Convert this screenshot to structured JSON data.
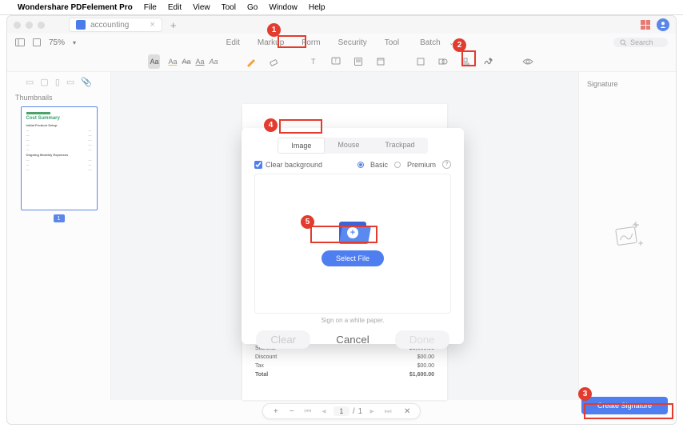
{
  "mac_menu": {
    "app_name": "Wondershare PDFelement Pro",
    "items": [
      "File",
      "Edit",
      "View",
      "Tool",
      "Go",
      "Window",
      "Help"
    ]
  },
  "document_tab": "accounting",
  "zoom": "75%",
  "ribbon": {
    "tabs": [
      "Edit",
      "Markup",
      "Form",
      "Security",
      "Tool",
      "Batch"
    ],
    "active": "Markup"
  },
  "search_placeholder": "Search",
  "sidebar": {
    "title": "Thumbnails",
    "page_number": "1"
  },
  "thumbnail": {
    "doc_title": "Cost Summary",
    "section1": "Initial Product Setup",
    "section2": "Ongoing Monthly Expenses"
  },
  "page_preview": {
    "rows": [
      {
        "label": "Subtotal",
        "value": "$1,600.00"
      },
      {
        "label": "Discount",
        "value": "$00.00"
      },
      {
        "label": "Tax",
        "value": "$00.00"
      },
      {
        "label": "Total",
        "value": "$1,600.00",
        "bold": true
      }
    ]
  },
  "right_panel": {
    "title": "Signature"
  },
  "pager": {
    "current": "1",
    "total": "1"
  },
  "dialog": {
    "tabs": [
      "Image",
      "Mouse",
      "Trackpad"
    ],
    "active": "Image",
    "clear_bg": "Clear background",
    "basic": "Basic",
    "premium": "Premium",
    "select_file": "Select File",
    "hint": "Sign on a white paper.",
    "clear": "Clear",
    "cancel": "Cancel",
    "done": "Done"
  },
  "create_signature": "Create Signature",
  "annotations": {
    "1": "1",
    "2": "2",
    "3": "3",
    "4": "4",
    "5": "5"
  }
}
